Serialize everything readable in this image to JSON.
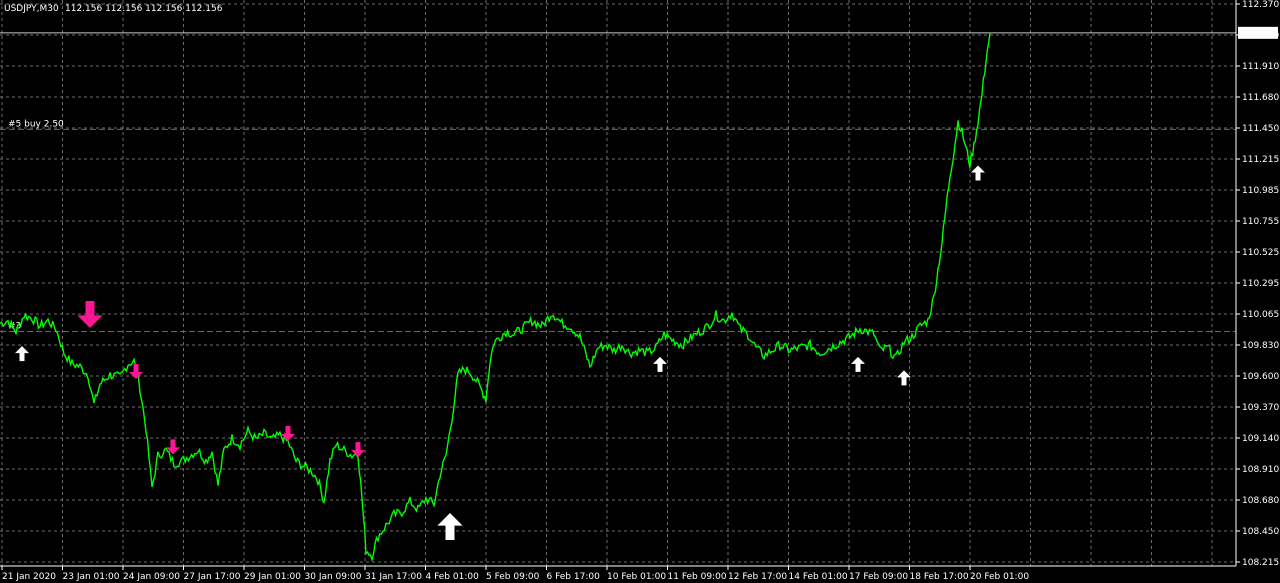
{
  "header": {
    "symbol": "USDJPY,M30",
    "ohlc": "112.156 112.156 112.156 112.156"
  },
  "colors": {
    "background": "#000000",
    "grid": "#6e6e6e",
    "axis": "#ffffff",
    "price_line": "#00ff00",
    "level_line": "#2d8c2d",
    "up_arrow": "#ffffff",
    "down_arrow": "#ff1493",
    "current_price_box": "#ffffff"
  },
  "chart_data": {
    "type": "line",
    "title": "USDJPY,M30",
    "ylim": [
      108.2,
      112.39
    ],
    "grid": true,
    "y_ticks": [
      "112.370",
      "112.140",
      "111.910",
      "111.680",
      "111.450",
      "111.215",
      "110.985",
      "110.755",
      "110.525",
      "110.295",
      "110.065",
      "109.830",
      "109.600",
      "109.370",
      "109.140",
      "108.910",
      "108.680",
      "108.450",
      "108.215"
    ],
    "x_tick_labels": [
      "21 Jan 2020",
      "23 Jan 01:00",
      "24 Jan 09:00",
      "27 Jan 17:00",
      "29 Jan 01:00",
      "30 Jan 09:00",
      "31 Jan 17:00",
      "4 Feb 01:00",
      "5 Feb 09:00",
      "6 Feb 17:00",
      "10 Feb 01:00",
      "11 Feb 09:00",
      "12 Feb 17:00",
      "14 Feb 01:00",
      "17 Feb 09:00",
      "18 Feb 17:00",
      "20 Feb 01:00"
    ],
    "current_price": "112.156",
    "current_price_value": 112.156,
    "levels": [
      {
        "label": "#5 buy 2.50",
        "value": 111.44
      },
      {
        "label": "#3 ",
        "value": 109.94
      }
    ],
    "series": [
      {
        "points": [
          [
            0,
            110.0
          ],
          [
            8,
            110.02
          ],
          [
            16,
            109.94
          ],
          [
            24,
            110.06
          ],
          [
            32,
            110.04
          ],
          [
            40,
            109.98
          ],
          [
            48,
            110.02
          ],
          [
            56,
            109.96
          ],
          [
            64,
            109.78
          ],
          [
            72,
            109.7
          ],
          [
            80,
            109.68
          ],
          [
            88,
            109.62
          ],
          [
            94,
            109.4
          ],
          [
            100,
            109.55
          ],
          [
            110,
            109.62
          ],
          [
            120,
            109.6
          ],
          [
            128,
            109.7
          ],
          [
            134,
            109.72
          ],
          [
            140,
            109.52
          ],
          [
            146,
            109.22
          ],
          [
            152,
            108.78
          ],
          [
            158,
            109.02
          ],
          [
            166,
            109.06
          ],
          [
            174,
            108.96
          ],
          [
            182,
            108.98
          ],
          [
            190,
            109.02
          ],
          [
            198,
            109.06
          ],
          [
            206,
            108.98
          ],
          [
            212,
            109.05
          ],
          [
            218,
            108.8
          ],
          [
            224,
            109.06
          ],
          [
            232,
            109.15
          ],
          [
            240,
            109.1
          ],
          [
            248,
            109.2
          ],
          [
            256,
            109.14
          ],
          [
            264,
            109.18
          ],
          [
            272,
            109.14
          ],
          [
            280,
            109.17
          ],
          [
            288,
            109.12
          ],
          [
            296,
            108.98
          ],
          [
            304,
            108.94
          ],
          [
            312,
            108.9
          ],
          [
            318,
            108.84
          ],
          [
            324,
            108.68
          ],
          [
            330,
            108.98
          ],
          [
            336,
            109.1
          ],
          [
            344,
            109.06
          ],
          [
            352,
            109.02
          ],
          [
            358,
            109.04
          ],
          [
            362,
            108.7
          ],
          [
            366,
            108.32
          ],
          [
            372,
            108.28
          ],
          [
            378,
            108.42
          ],
          [
            386,
            108.5
          ],
          [
            394,
            108.58
          ],
          [
            402,
            108.6
          ],
          [
            410,
            108.68
          ],
          [
            418,
            108.62
          ],
          [
            426,
            108.7
          ],
          [
            434,
            108.66
          ],
          [
            440,
            108.88
          ],
          [
            446,
            109.02
          ],
          [
            452,
            109.3
          ],
          [
            458,
            109.62
          ],
          [
            464,
            109.66
          ],
          [
            470,
            109.64
          ],
          [
            476,
            109.58
          ],
          [
            482,
            109.5
          ],
          [
            486,
            109.44
          ],
          [
            490,
            109.72
          ],
          [
            494,
            109.86
          ],
          [
            500,
            109.9
          ],
          [
            506,
            109.94
          ],
          [
            514,
            109.92
          ],
          [
            522,
            109.96
          ],
          [
            532,
            110.02
          ],
          [
            542,
            109.98
          ],
          [
            552,
            110.08
          ],
          [
            562,
            110.0
          ],
          [
            570,
            109.98
          ],
          [
            580,
            109.9
          ],
          [
            590,
            109.68
          ],
          [
            598,
            109.82
          ],
          [
            606,
            109.84
          ],
          [
            614,
            109.8
          ],
          [
            622,
            109.84
          ],
          [
            630,
            109.78
          ],
          [
            640,
            109.8
          ],
          [
            648,
            109.78
          ],
          [
            656,
            109.82
          ],
          [
            664,
            109.92
          ],
          [
            672,
            109.88
          ],
          [
            682,
            109.84
          ],
          [
            692,
            109.9
          ],
          [
            700,
            109.94
          ],
          [
            708,
            109.98
          ],
          [
            716,
            110.06
          ],
          [
            724,
            110.02
          ],
          [
            732,
            110.08
          ],
          [
            740,
            109.96
          ],
          [
            748,
            109.92
          ],
          [
            756,
            109.82
          ],
          [
            764,
            109.76
          ],
          [
            772,
            109.8
          ],
          [
            780,
            109.84
          ],
          [
            790,
            109.8
          ],
          [
            800,
            109.82
          ],
          [
            810,
            109.84
          ],
          [
            820,
            109.78
          ],
          [
            830,
            109.82
          ],
          [
            840,
            109.86
          ],
          [
            850,
            109.9
          ],
          [
            860,
            109.96
          ],
          [
            868,
            109.94
          ],
          [
            874,
            109.92
          ],
          [
            880,
            109.8
          ],
          [
            888,
            109.82
          ],
          [
            896,
            109.74
          ],
          [
            904,
            109.86
          ],
          [
            912,
            109.9
          ],
          [
            920,
            109.98
          ],
          [
            928,
            110.02
          ],
          [
            934,
            110.2
          ],
          [
            938,
            110.4
          ],
          [
            942,
            110.6
          ],
          [
            946,
            110.86
          ],
          [
            950,
            111.1
          ],
          [
            954,
            111.28
          ],
          [
            958,
            111.5
          ],
          [
            962,
            111.42
          ],
          [
            966,
            111.3
          ],
          [
            970,
            111.18
          ],
          [
            974,
            111.32
          ],
          [
            978,
            111.5
          ],
          [
            982,
            111.7
          ],
          [
            986,
            111.96
          ],
          [
            990,
            112.156
          ]
        ]
      }
    ],
    "markers": [
      {
        "type": "up",
        "x": 22,
        "value": 109.78,
        "size": "small"
      },
      {
        "type": "down",
        "x": 90,
        "value": 110.06,
        "size": "large"
      },
      {
        "type": "down",
        "x": 136,
        "value": 109.64,
        "size": "small"
      },
      {
        "type": "down",
        "x": 173,
        "value": 109.08,
        "size": "small"
      },
      {
        "type": "down",
        "x": 288,
        "value": 109.18,
        "size": "small"
      },
      {
        "type": "down",
        "x": 358,
        "value": 109.06,
        "size": "small"
      },
      {
        "type": "up",
        "x": 450,
        "value": 108.5,
        "size": "large"
      },
      {
        "type": "up",
        "x": 660,
        "value": 109.7,
        "size": "small"
      },
      {
        "type": "up",
        "x": 858,
        "value": 109.7,
        "size": "small"
      },
      {
        "type": "up",
        "x": 904,
        "value": 109.6,
        "size": "small"
      },
      {
        "type": "up",
        "x": 978,
        "value": 111.12,
        "size": "small"
      }
    ]
  }
}
